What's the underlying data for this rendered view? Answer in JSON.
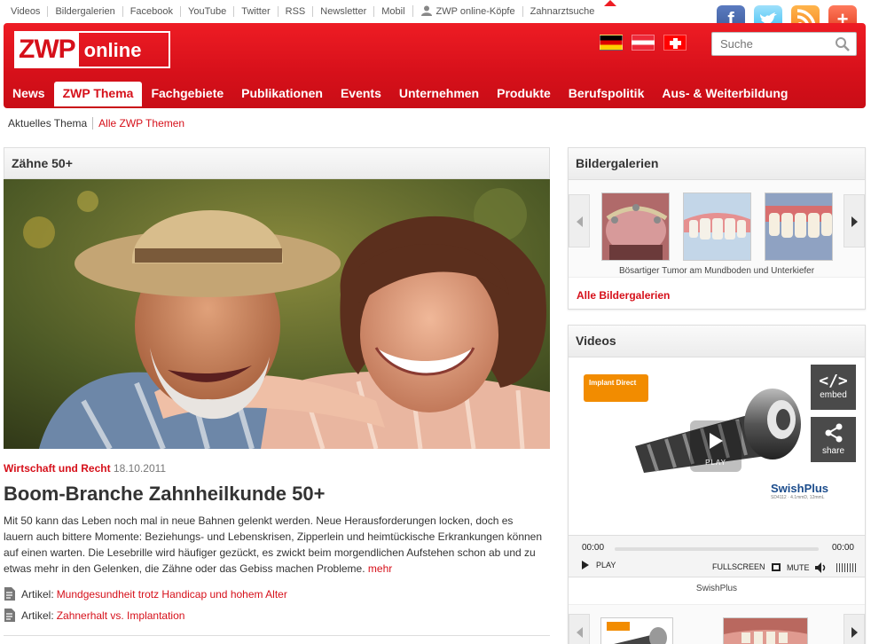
{
  "toplinks": [
    "Videos",
    "Bildergalerien",
    "Facebook",
    "YouTube",
    "Twitter",
    "RSS",
    "Newsletter",
    "Mobil",
    "ZWP online-Köpfe",
    "Zahnarztsuche"
  ],
  "social": [
    "facebook-icon",
    "twitter-icon",
    "rss-icon",
    "plus-icon"
  ],
  "logo": {
    "part1": "ZWP",
    "part2": "online"
  },
  "brand_color": "#d6101a",
  "search": {
    "placeholder": "Suche"
  },
  "nav": [
    "News",
    "ZWP Thema",
    "Fachgebiete",
    "Publikationen",
    "Events",
    "Unternehmen",
    "Produkte",
    "Berufspolitik",
    "Aus- & Weiterbildung"
  ],
  "nav_active": "ZWP Thema",
  "subnav": {
    "current": "Aktuelles Thema",
    "link": "Alle ZWP Themen"
  },
  "main": {
    "box_title": "Zähne 50+",
    "category": "Wirtschaft und Recht",
    "date": "18.10.2011",
    "headline": "Boom-Branche Zahnheilkunde 50+",
    "teaser": "Mit 50 kann das Leben noch mal in neue Bahnen gelenkt werden. Neue Herausforderungen locken, doch es lauern auch bittere Momente: Beziehungs- und Lebenskrisen, Zipperlein und heimtückische Erkrankungen können auf einen warten. Die Lesebrille wird häufiger gezückt, es zwickt beim morgendlichen Aufstehen schon ab und zu etwas mehr in den Gelenken, die Zähne oder das Gebiss machen Probleme.",
    "more": "mehr",
    "articles": [
      {
        "label": "Artikel:",
        "title": "Mundgesundheit trotz Handicap und hohem Alter"
      },
      {
        "label": "Artikel:",
        "title": "Zahnerhalt vs. Implantation"
      }
    ]
  },
  "gallery": {
    "title": "Bildergalerien",
    "caption": "Bösartiger Tumor am Mundboden und Unterkiefer",
    "all_link": "Alle Bildergalerien"
  },
  "videos": {
    "title": "Videos",
    "logo_text": "Implant Direct",
    "product_text": "SwishPlus",
    "product_sub": "SD4112 · 4.1mmD, 12mmL",
    "play_label": "PLAY",
    "embed_label": "embed",
    "share_label": "share",
    "time_current": "00:00",
    "time_total": "00:00",
    "ctrl_play": "PLAY",
    "ctrl_fullscreen": "FULLSCREEN",
    "ctrl_mute": "MUTE",
    "caption": "SwishPlus"
  }
}
